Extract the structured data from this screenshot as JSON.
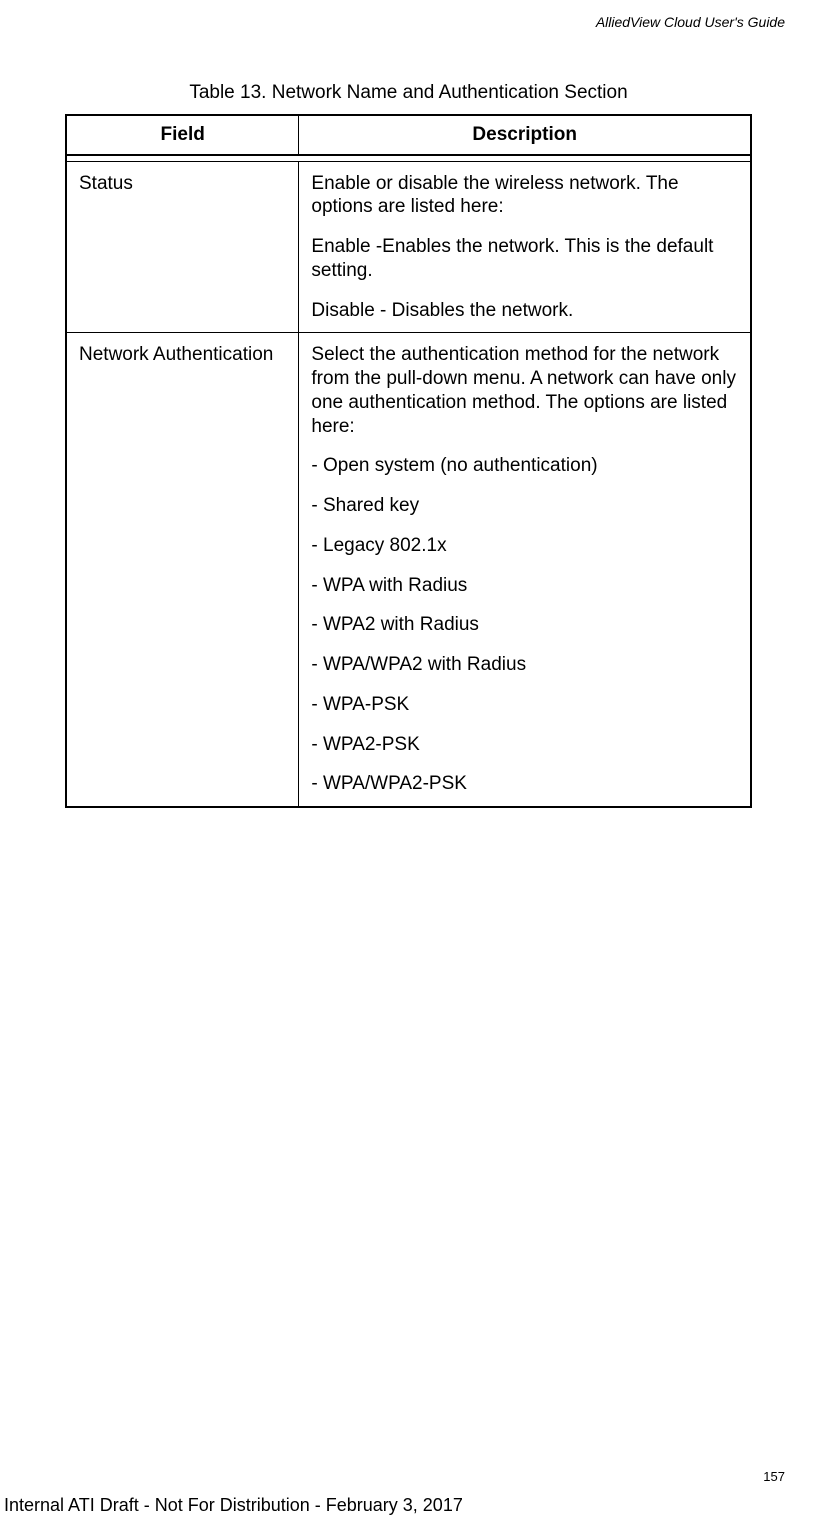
{
  "header": {
    "doc_title": "AlliedView Cloud User's Guide"
  },
  "table": {
    "caption": "Table 13. Network Name and Authentication Section",
    "headers": {
      "field": "Field",
      "description": "Description"
    },
    "rows": [
      {
        "field": "Status",
        "description": [
          "Enable or disable the wireless network. The options are listed here:",
          "Enable -Enables the network. This is the default setting.",
          "Disable - Disables the network."
        ]
      },
      {
        "field": "Network Authentication",
        "description": [
          "Select the authentication method for the network from the pull-down menu. A network can have only one authentication method. The options are listed here:",
          "- Open system (no authentication)",
          "- Shared key",
          "- Legacy 802.1x",
          "- WPA with Radius",
          "- WPA2 with Radius",
          "- WPA/WPA2 with Radius",
          "- WPA-PSK",
          "- WPA2-PSK",
          "- WPA/WPA2-PSK"
        ]
      }
    ]
  },
  "footer": {
    "page_number": "157",
    "note": "Internal ATI Draft - Not For Distribution - February 3, 2017"
  }
}
